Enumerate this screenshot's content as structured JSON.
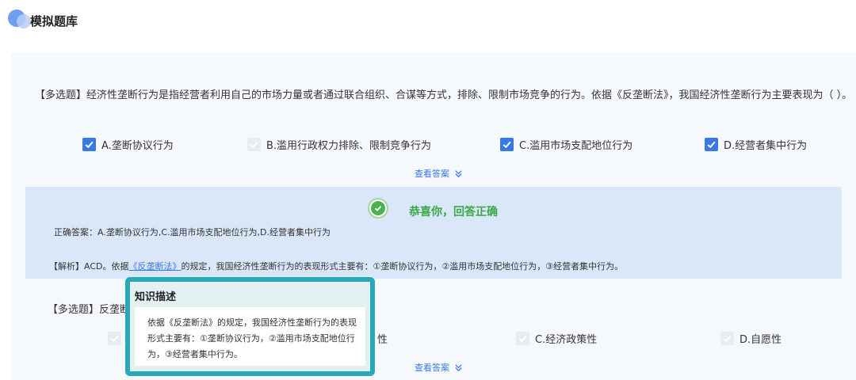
{
  "header": {
    "title": "模拟题库"
  },
  "question1": {
    "text": "【多选题】经济性垄断行为是指经营者利用自己的市场力量或者通过联合组织、合谋等方式，排除、限制市场竞争的行为。依据《反垄断法》，我国经济性垄断行为主要表现为（   ）。",
    "options": [
      {
        "label": "A.垄断协议行为",
        "state": "checked"
      },
      {
        "label": "B.滥用行政权力排除、限制竞争行为",
        "state": "disabled"
      },
      {
        "label": "C.滥用市场支配地位行为",
        "state": "checked"
      },
      {
        "label": "D.经营者集中行为",
        "state": "checked"
      }
    ],
    "see_answer": "查看答案"
  },
  "result": {
    "message": "恭喜你，回答正确",
    "correct_answer": "正确答案：A.垄断协议行为,C.滥用市场支配地位行为,D.经营者集中行为",
    "analysis_prefix": "【解析】ACD。依据",
    "analysis_link": "《反垄断法》",
    "analysis_suffix": "的规定，我国经济性垄断行为的表现形式主要有：①垄断协议行为，②滥用市场支配地位行为，③经营者集中行为。"
  },
  "question2": {
    "text_visible": "【多选题】反垄断",
    "options": [
      {
        "label": "性",
        "state": "disabled"
      },
      {
        "label": "C.经济政策性",
        "state": "disabled"
      },
      {
        "label": "D.自愿性",
        "state": "disabled"
      }
    ],
    "see_answer": "查看答案"
  },
  "knowledge_popup": {
    "title": "知识描述",
    "body": "依据《反垄断法》的规定，我国经济性垄断行为的表现形式主要有：①垄断协议行为，②滥用市场支配地位行为，③经营者集中行为。"
  },
  "colors": {
    "accent": "#3a78e6",
    "success": "#3aa844",
    "popup_border": "#2aa8b6",
    "result_bg": "#d9e7f8"
  },
  "icons": {
    "check": "check-icon",
    "chevron": "double-chevron-down-icon",
    "success": "check-circle-icon"
  }
}
